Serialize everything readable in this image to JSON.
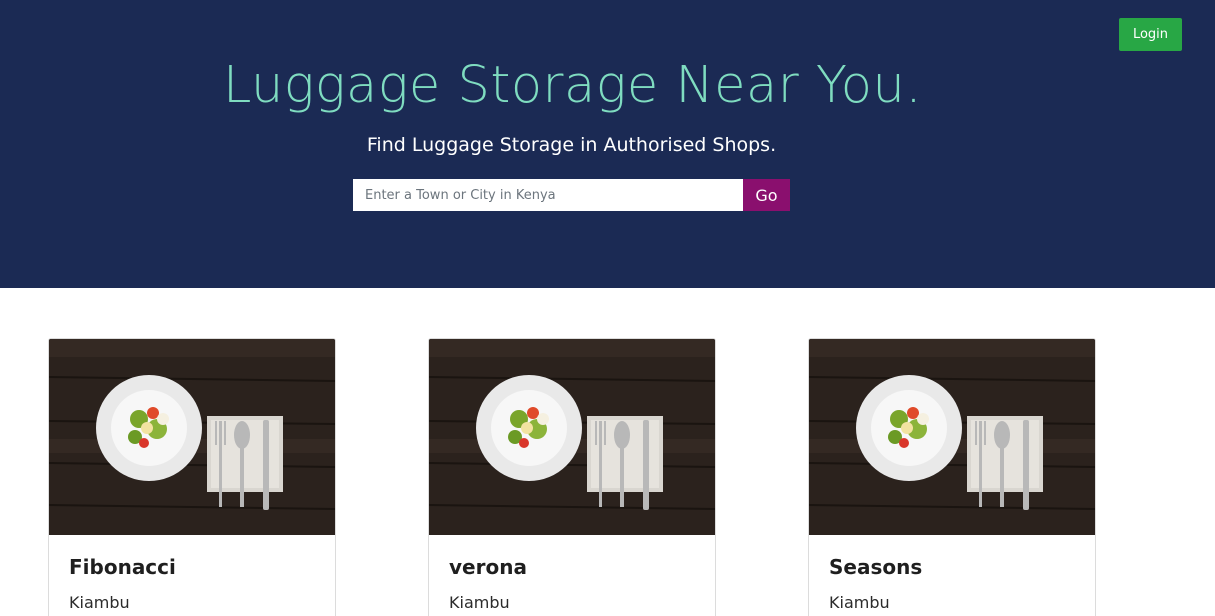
{
  "header": {
    "login_label": "Login",
    "title": "Luggage Storage Near You.",
    "subtitle": "Find Luggage Storage in Authorised Shops.",
    "search_placeholder": "Enter a Town or City in Kenya",
    "search_value": "",
    "go_label": "Go"
  },
  "colors": {
    "hero_bg": "#1b2a54",
    "title": "#7fdcc0",
    "login_button": "#28a745",
    "go_button": "#8a0f6e"
  },
  "listings": [
    {
      "name": "Fibonacci",
      "location": "Kiambu",
      "image_icon": "food-plate-photo"
    },
    {
      "name": "verona",
      "location": "Kiambu",
      "image_icon": "food-plate-photo"
    },
    {
      "name": "Seasons",
      "location": "Kiambu",
      "image_icon": "food-plate-photo"
    }
  ]
}
